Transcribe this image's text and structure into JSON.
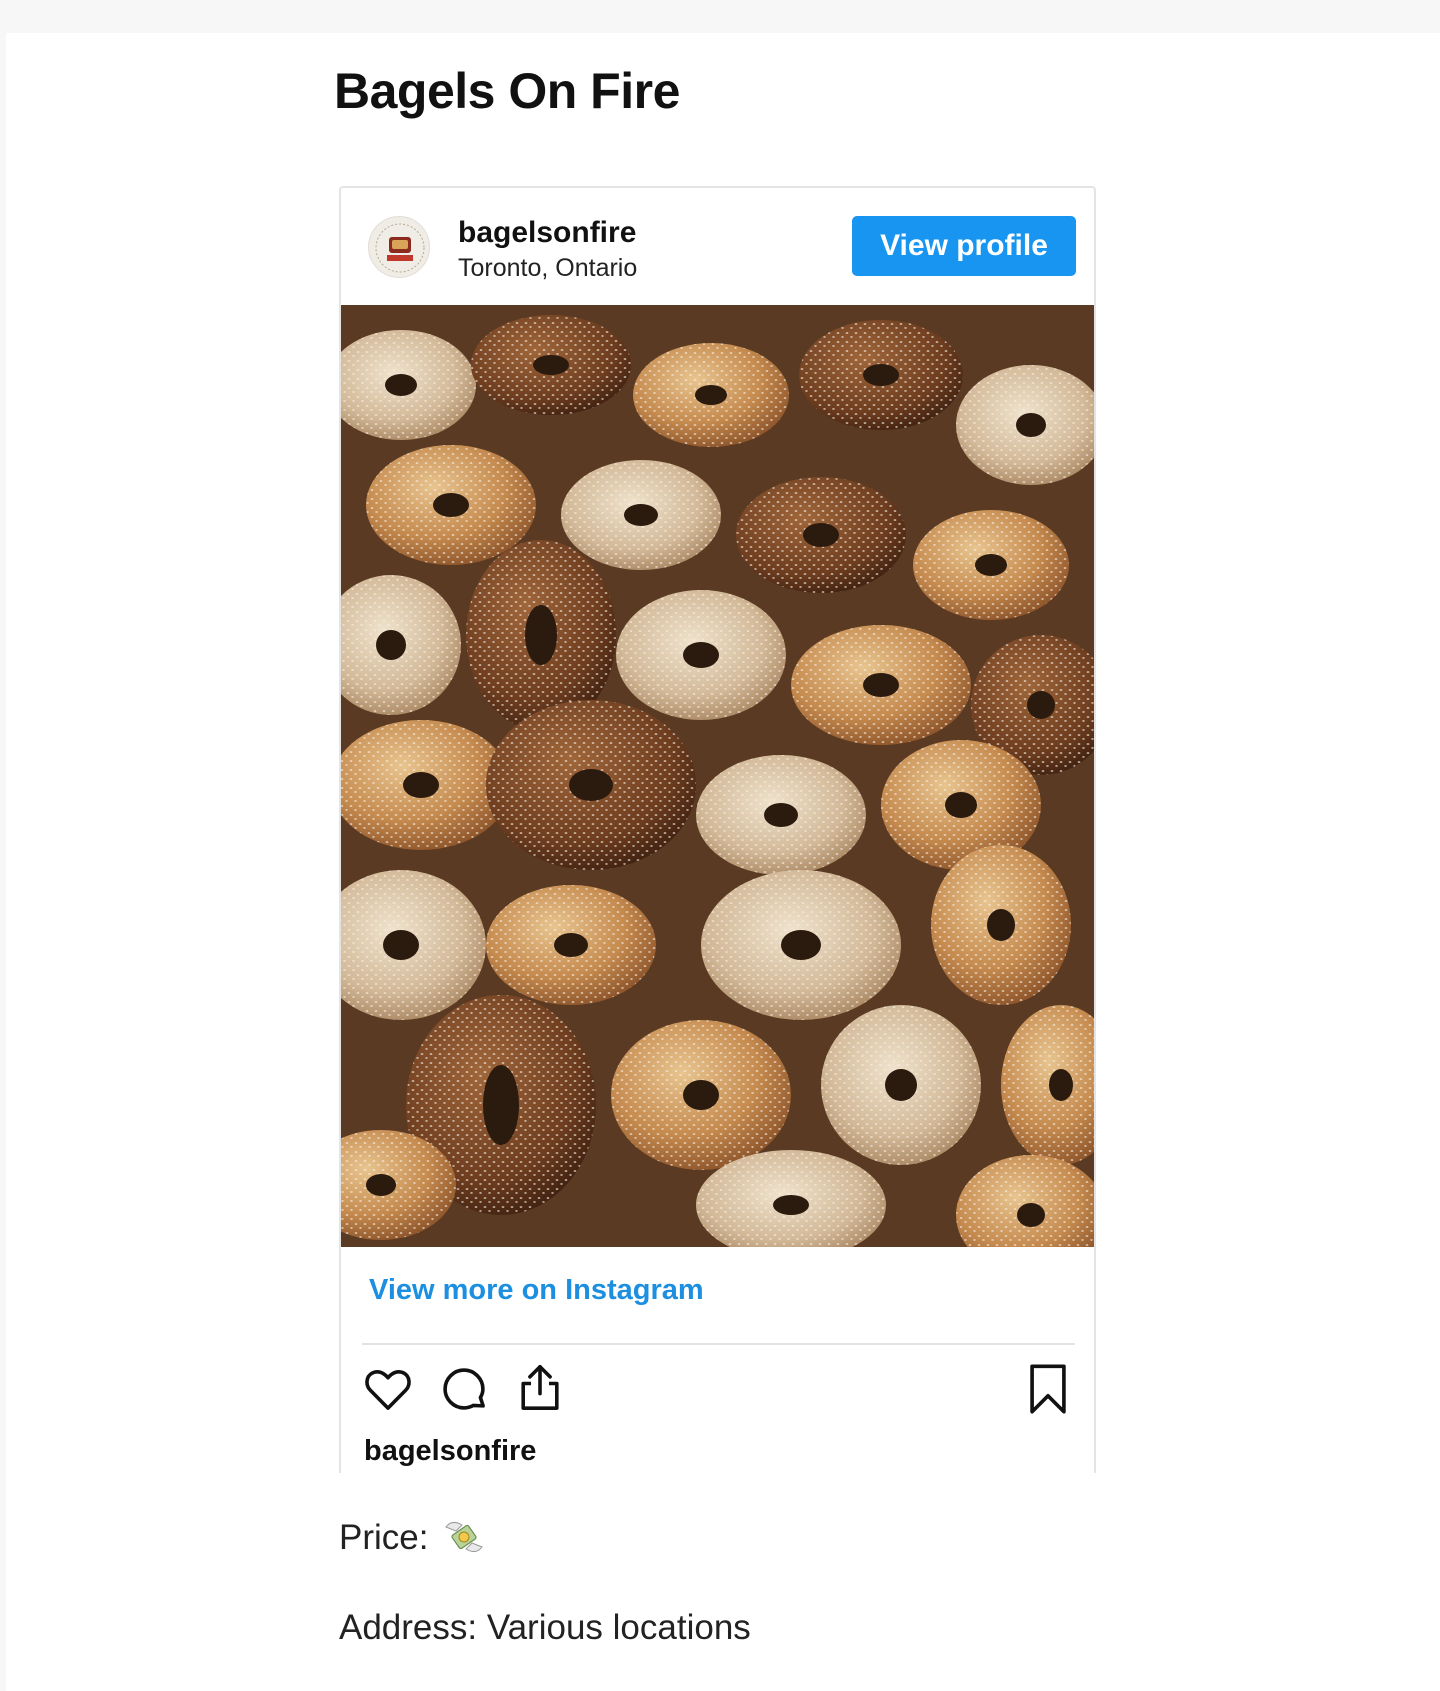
{
  "page": {
    "title": "Bagels On Fire"
  },
  "embed": {
    "username": "bagelsonfire",
    "location": "Toronto, Ontario",
    "view_profile_label": "View profile",
    "view_more_label": "View more on Instagram",
    "footer_username": "bagelsonfire",
    "photo_subject": "pile of sesame and poppy seed bagels",
    "icons": [
      "heart-icon",
      "comment-icon",
      "share-icon",
      "bookmark-icon"
    ]
  },
  "details": {
    "price_label": "Price:",
    "price_icon": "money-with-wings-icon",
    "address_label": "Address:",
    "address_value": "Various locations",
    "address_text": "Address: Various locations"
  },
  "colors": {
    "accent": "#1795f0",
    "link": "#1d8fe0",
    "border": "#e4e4e4"
  }
}
